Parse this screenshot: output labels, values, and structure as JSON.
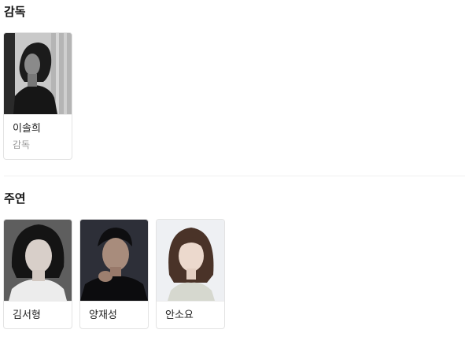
{
  "director_section": {
    "title": "감독",
    "people": [
      {
        "name": "이솔희",
        "role": "감독",
        "photo": "director-portrait"
      }
    ]
  },
  "cast_section": {
    "title": "주연",
    "people": [
      {
        "name": "김서형",
        "photo": "actor-portrait"
      },
      {
        "name": "양재성",
        "photo": "actor-portrait"
      },
      {
        "name": "안소요",
        "photo": "actress-portrait"
      }
    ]
  },
  "colors": {
    "card_border": "#e3e3e3",
    "role_text": "#9a9a9a",
    "divider": "#efefef"
  }
}
